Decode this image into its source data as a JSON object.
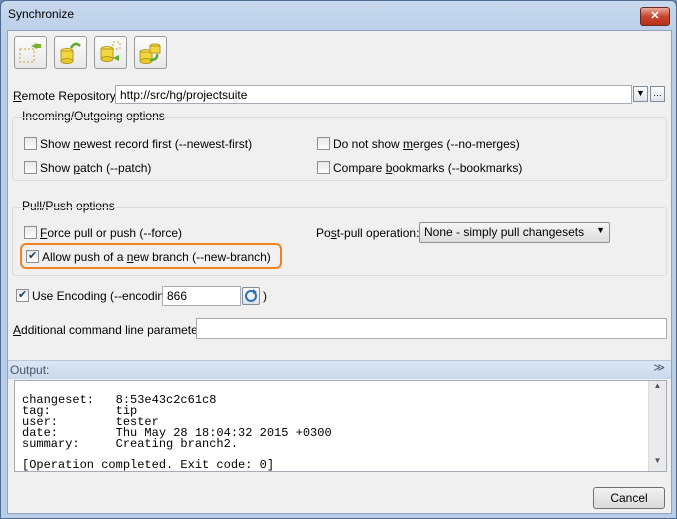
{
  "window": {
    "title": "Synchronize",
    "close_glyph": "✕"
  },
  "toolbar": [
    {
      "icon": "repository-incoming-icon"
    },
    {
      "icon": "repository-pull-icon"
    },
    {
      "icon": "repository-outgoing-icon"
    },
    {
      "icon": "repository-push-icon"
    }
  ],
  "remote": {
    "label_u": "R",
    "label_rest": "emote Repository:",
    "value": "http://src/hg/projectsuite",
    "dropdown_glyph": "▼",
    "browse_glyph": "…"
  },
  "incoming_outgoing": {
    "title": "Incoming/Outgoing options",
    "options": [
      {
        "pre": "Show ",
        "u": "n",
        "post": "ewest record first (--newest-first)",
        "checked": false
      },
      {
        "pre": "Do not show ",
        "u": "m",
        "post": "erges (--no-merges)",
        "checked": false
      },
      {
        "pre": "Show ",
        "u": "p",
        "post": "atch (--patch)",
        "checked": false
      },
      {
        "pre": "Compare ",
        "u": "b",
        "post": "ookmarks (--bookmarks)",
        "checked": false
      }
    ]
  },
  "pull_push": {
    "title": "Pull/Push options",
    "force": {
      "u": "F",
      "post": "orce pull or push (--force)",
      "checked": false
    },
    "new_branch": {
      "pre": "Allow push of a ",
      "u": "n",
      "post": "ew branch (--new-branch)",
      "checked": true
    },
    "post_pull_label_pre": "Po",
    "post_pull_label_u": "s",
    "post_pull_label_post": "t-pull operation:",
    "post_pull_value": "None - simply pull changesets",
    "combo_glyph": "▼"
  },
  "encoding": {
    "label_pre": "Use Encoding (--encoding=",
    "value": "866",
    "close_paren": ")",
    "checked": true,
    "refresh_icon": "refresh-icon"
  },
  "additional": {
    "label_pre": "A",
    "label_rest": "dditional command line parameters:",
    "value": ""
  },
  "output": {
    "label": "Output:",
    "collapse_glyph": "≫",
    "lines": [
      "changeset:   8:53e43c2c61c8",
      "tag:         tip",
      "user:        tester",
      "date:        Thu May 28 18:04:32 2015 +0300",
      "summary:     Creating branch2.",
      "",
      "[Operation completed. Exit code: 0]"
    ]
  },
  "cancel": {
    "label": "Cancel"
  },
  "colors": {
    "highlight": "#f2821f",
    "accent": "#1c3e70"
  }
}
